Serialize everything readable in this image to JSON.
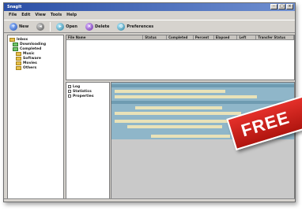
{
  "window": {
    "title": "SnagIt"
  },
  "menu": [
    "File",
    "Edit",
    "View",
    "Tools",
    "Help"
  ],
  "toolbar": {
    "buttons": [
      {
        "label": "New",
        "icon": "new-icon"
      },
      {
        "label": "",
        "icon": "back-icon"
      },
      {
        "label": "Open",
        "icon": "open-icon"
      },
      {
        "label": "Delete",
        "icon": "delete-icon"
      },
      {
        "label": "Preferences",
        "icon": "preferences-icon"
      }
    ]
  },
  "tree": {
    "items": [
      {
        "label": "Inbox",
        "color": "yellow"
      },
      {
        "label": "Downloading",
        "color": "green"
      },
      {
        "label": "Completed",
        "color": "green"
      },
      {
        "label": "Music",
        "color": "yellow"
      },
      {
        "label": "Software",
        "color": "yellow"
      },
      {
        "label": "Movies",
        "color": "yellow"
      },
      {
        "label": "Others",
        "color": "yellow"
      }
    ]
  },
  "list": {
    "columns": [
      "File Name",
      "Status",
      "Completed",
      "Percent",
      "Elapsed",
      "Left",
      "Transfer Status"
    ]
  },
  "props": {
    "items": [
      "Log",
      "Statistics",
      "Properties"
    ]
  },
  "banner": {
    "text": "FREE"
  }
}
